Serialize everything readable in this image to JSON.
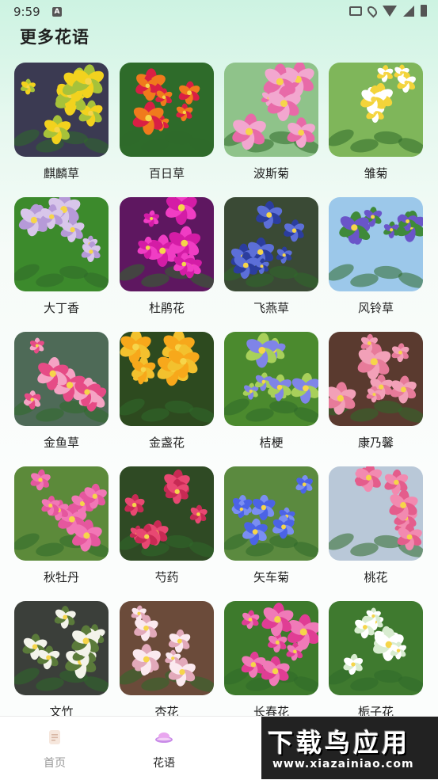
{
  "status_bar": {
    "time": "9:59",
    "notification_letter": "A"
  },
  "page": {
    "title": "更多花语"
  },
  "flowers": [
    {
      "name": "麒麟草",
      "bg": "#3b3a52",
      "accent": "#f2d21e",
      "accent2": "#a7c23a"
    },
    {
      "name": "百日草",
      "bg": "#2e6b2a",
      "accent": "#f07a1c",
      "accent2": "#d91f44"
    },
    {
      "name": "波斯菊",
      "bg": "#8fc38a",
      "accent": "#f2a7cf",
      "accent2": "#e86aa8"
    },
    {
      "name": "雏菊",
      "bg": "#7fb65a",
      "accent": "#ffffff",
      "accent2": "#f3d43a"
    },
    {
      "name": "大丁香",
      "bg": "#3c8a2c",
      "accent": "#d8c6ea",
      "accent2": "#b69ad8"
    },
    {
      "name": "杜鹃花",
      "bg": "#5e1760",
      "accent": "#d41ca6",
      "accent2": "#f03dc4"
    },
    {
      "name": "飞燕草",
      "bg": "#3a4a35",
      "accent": "#5c6fd8",
      "accent2": "#2b3d9e"
    },
    {
      "name": "风铃草",
      "bg": "#9cc8ea",
      "accent": "#6a55c9",
      "accent2": "#3f8a3a"
    },
    {
      "name": "金鱼草",
      "bg": "#4e6a57",
      "accent": "#e64b86",
      "accent2": "#f5a3c4"
    },
    {
      "name": "金盏花",
      "bg": "#2d4a1f",
      "accent": "#f7a81b",
      "accent2": "#f3c12e"
    },
    {
      "name": "桔梗",
      "bg": "#4b8a2e",
      "accent": "#7f84e8",
      "accent2": "#a8d05a"
    },
    {
      "name": "康乃馨",
      "bg": "#5a3a2f",
      "accent": "#f2a0b8",
      "accent2": "#e77b9a"
    },
    {
      "name": "秋牡丹",
      "bg": "#5c8a3a",
      "accent": "#f277b6",
      "accent2": "#e5579e"
    },
    {
      "name": "芍药",
      "bg": "#2f4a24",
      "accent": "#e84872",
      "accent2": "#c72a54"
    },
    {
      "name": "矢车菊",
      "bg": "#5b8a3f",
      "accent": "#4b63e6",
      "accent2": "#7a8ef2"
    },
    {
      "name": "桃花",
      "bg": "#b9c8d8",
      "accent": "#f28ab0",
      "accent2": "#e45d8c"
    },
    {
      "name": "文竹",
      "bg": "#3b3f3a",
      "accent": "#f3f3ea",
      "accent2": "#5a7a3a"
    },
    {
      "name": "杏花",
      "bg": "#6b4b3a",
      "accent": "#fbe9ef",
      "accent2": "#e2a9ba"
    },
    {
      "name": "长春花",
      "bg": "#3d7a2c",
      "accent": "#f07ab8",
      "accent2": "#e03d94"
    },
    {
      "name": "栀子花",
      "bg": "#3f7a2f",
      "accent": "#ffffff",
      "accent2": "#d8ecd0"
    }
  ],
  "bottom_nav": [
    {
      "label": "首页",
      "icon": "document-icon",
      "active": false
    },
    {
      "label": "花语",
      "icon": "cloud-hat-icon",
      "active": true
    }
  ],
  "watermark": {
    "main": "下载鸟应用",
    "sub": "www.xiazainiao.com"
  }
}
